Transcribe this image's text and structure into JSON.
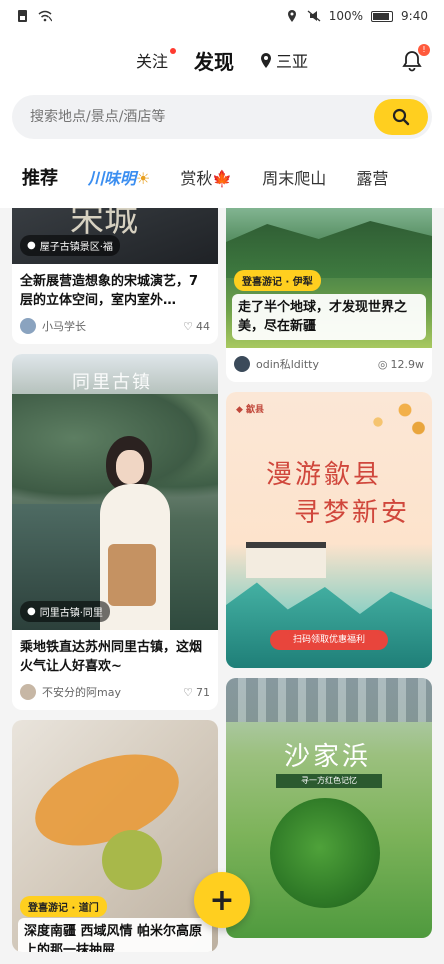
{
  "status_bar": {
    "battery": "100%",
    "time": "9:40"
  },
  "header": {
    "follow": "关注",
    "discover": "发现",
    "city": "三亚"
  },
  "search": {
    "placeholder": "搜索地点/景点/酒店等"
  },
  "categories": [
    "推荐",
    "川味明",
    "赏秋",
    "周末爬山",
    "露营"
  ],
  "feed": {
    "left": [
      {
        "location": "屋子古镇景区·福",
        "title": "全新展营造想象的宋城演艺，7层的立体空间，室内室外…",
        "user": "小马学长",
        "likes": "44",
        "overlay_text": "宋城"
      },
      {
        "location": "同里古镇·同里",
        "title": "乘地铁直达苏州同里古镇，这烟火气让人好喜欢~",
        "user": "不安分的阿may",
        "likes": "71",
        "overlay_text": "同里古镇"
      },
      {
        "badge": "登喜游记 · 道门",
        "title": "深度南疆 西域风情 帕米尔高原上的那一抹抽屉",
        "user": "",
        "likes": ""
      }
    ],
    "right": [
      {
        "badge": "登喜游记 · 伊犁",
        "title": "走了半个地球，才发现世界之美，尽在新疆",
        "user": "odin私lditty",
        "likes": "12.9w"
      },
      {
        "poster_title_1": "漫游歙县",
        "poster_title_2": "寻梦新安",
        "poster_button": "扫码领取优惠福利"
      },
      {
        "poster_title": "沙家浜",
        "poster_sub": "寻一方红色记忆",
        "user": "",
        "likes": ""
      }
    ]
  },
  "fab": {
    "label": "+"
  }
}
